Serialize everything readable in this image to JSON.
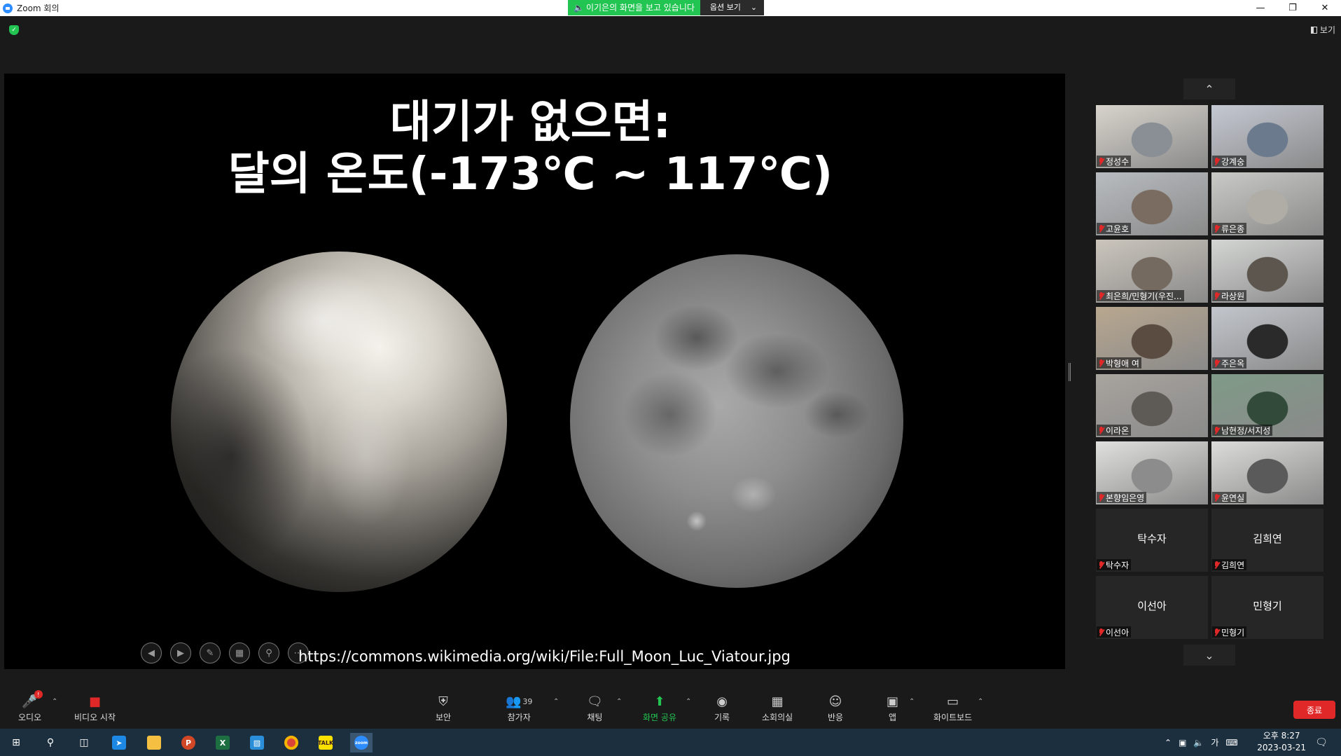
{
  "window": {
    "title": "Zoom 회의",
    "share_banner": "이기은의 화면을 보고 있습니다",
    "options_label": "옵션 보기",
    "view_label": "보기"
  },
  "slide": {
    "title_line1": "대기가 없으면:",
    "title_line2": "달의 온도(-173℃ ~ 117℃)",
    "source_url": "https://commons.wikimedia.org/wiki/File:Full_Moon_Luc_Viatour.jpg"
  },
  "participants": [
    {
      "name": "정성수",
      "video": true
    },
    {
      "name": "강계숭",
      "video": true
    },
    {
      "name": "고윤호",
      "video": true
    },
    {
      "name": "류은종",
      "video": true
    },
    {
      "name": "최은희/민형기(우진...",
      "video": true
    },
    {
      "name": "라상원",
      "video": true
    },
    {
      "name": "박형애 여",
      "video": true
    },
    {
      "name": "주은옥",
      "video": true
    },
    {
      "name": "이라온",
      "video": true
    },
    {
      "name": "남현정/서지성",
      "video": true
    },
    {
      "name": "본향임은영",
      "video": true
    },
    {
      "name": "윤연실",
      "video": true
    },
    {
      "name": "탁수자",
      "video": false
    },
    {
      "name": "김희연",
      "video": false
    },
    {
      "name": "이선아",
      "video": false
    },
    {
      "name": "민형기",
      "video": false
    }
  ],
  "toolbar": {
    "audio": "오디오",
    "video": "비디오 시작",
    "security": "보안",
    "participants": "참가자",
    "participant_count": "39",
    "chat": "채팅",
    "share": "화면 공유",
    "record": "기록",
    "breakout": "소회의실",
    "reactions": "반응",
    "apps": "앱",
    "whiteboard": "화이트보드",
    "end": "종료",
    "audio_badge": "!"
  },
  "taskbar": {
    "time": "오후 8:27",
    "date": "2023-03-21",
    "ime": "가"
  }
}
